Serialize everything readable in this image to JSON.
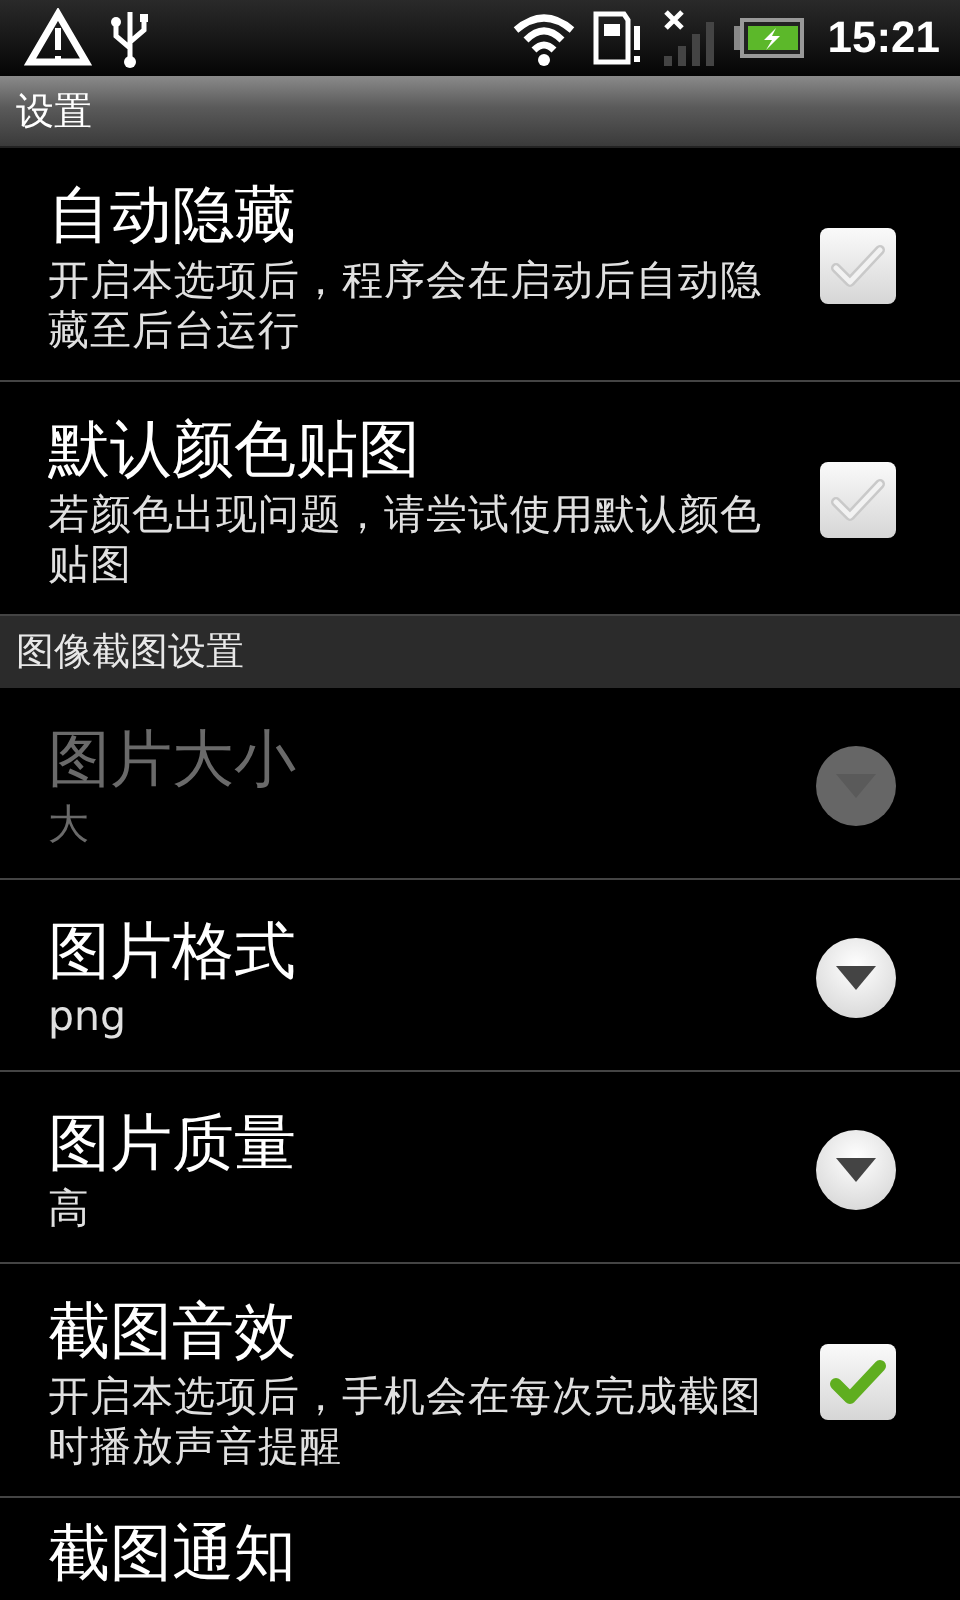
{
  "status_bar": {
    "time": "15:21"
  },
  "title_bar": {
    "title": "设置"
  },
  "sections": [
    {
      "items": [
        {
          "kind": "checkbox",
          "title": "自动隐藏",
          "summary": "开启本选项后，程序会在启动后自动隐藏至后台运行",
          "checked": false,
          "disabled": false
        },
        {
          "kind": "checkbox",
          "title": "默认颜色贴图",
          "summary": "若颜色出现问题，请尝试使用默认颜色贴图",
          "checked": false,
          "disabled": false
        }
      ]
    },
    {
      "header": "图像截图设置",
      "items": [
        {
          "kind": "dropdown",
          "title": "图片大小",
          "summary": "大",
          "disabled": true
        },
        {
          "kind": "dropdown",
          "title": "图片格式",
          "summary": "png",
          "disabled": false
        },
        {
          "kind": "dropdown",
          "title": "图片质量",
          "summary": "高",
          "disabled": false
        },
        {
          "kind": "checkbox",
          "title": "截图音效",
          "summary": "开启本选项后，手机会在每次完成截图时播放声音提醒",
          "checked": true,
          "disabled": false
        },
        {
          "kind": "title_only",
          "title": "截图通知",
          "disabled": false
        }
      ]
    }
  ]
}
